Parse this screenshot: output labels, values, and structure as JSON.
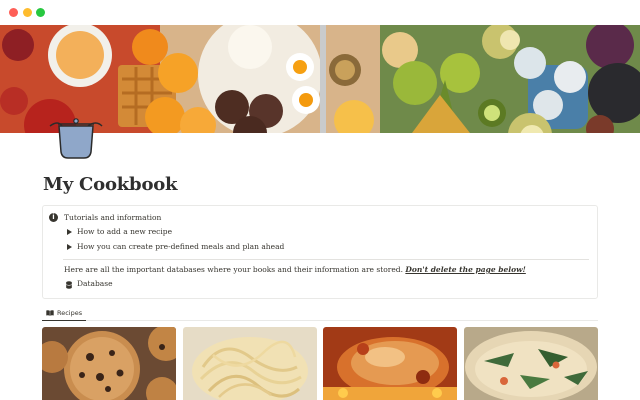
{
  "window": {
    "traffic_lights": [
      "close",
      "minimize",
      "zoom"
    ],
    "colors": {
      "close": "#fe5f57",
      "minimize": "#febc2e",
      "zoom": "#28c840"
    }
  },
  "cover": {
    "icon": "breakfast-cover-image"
  },
  "page_icon": {
    "icon": "cooking-pot-icon"
  },
  "page": {
    "title": "My Cookbook"
  },
  "callout": {
    "icon": "info-icon",
    "heading": "Tutorials and information",
    "toggles": [
      {
        "label": "How to add a new recipe"
      },
      {
        "label": "How you can create pre-defined meals and plan ahead"
      }
    ],
    "note": "Here are all the important databases  where your books and their information are stored.",
    "warning": "Don't delete the page below!",
    "database_link": "Database"
  },
  "view": {
    "tabs": [
      {
        "label": "Recipes",
        "icon": "book-icon"
      }
    ]
  },
  "gallery": {
    "cards": [
      {
        "image": "chocolate-chip-cookies-image"
      },
      {
        "image": "spaghetti-pasta-image"
      },
      {
        "image": "roasted-chicken-image"
      },
      {
        "image": "creamy-soup-image"
      }
    ]
  }
}
